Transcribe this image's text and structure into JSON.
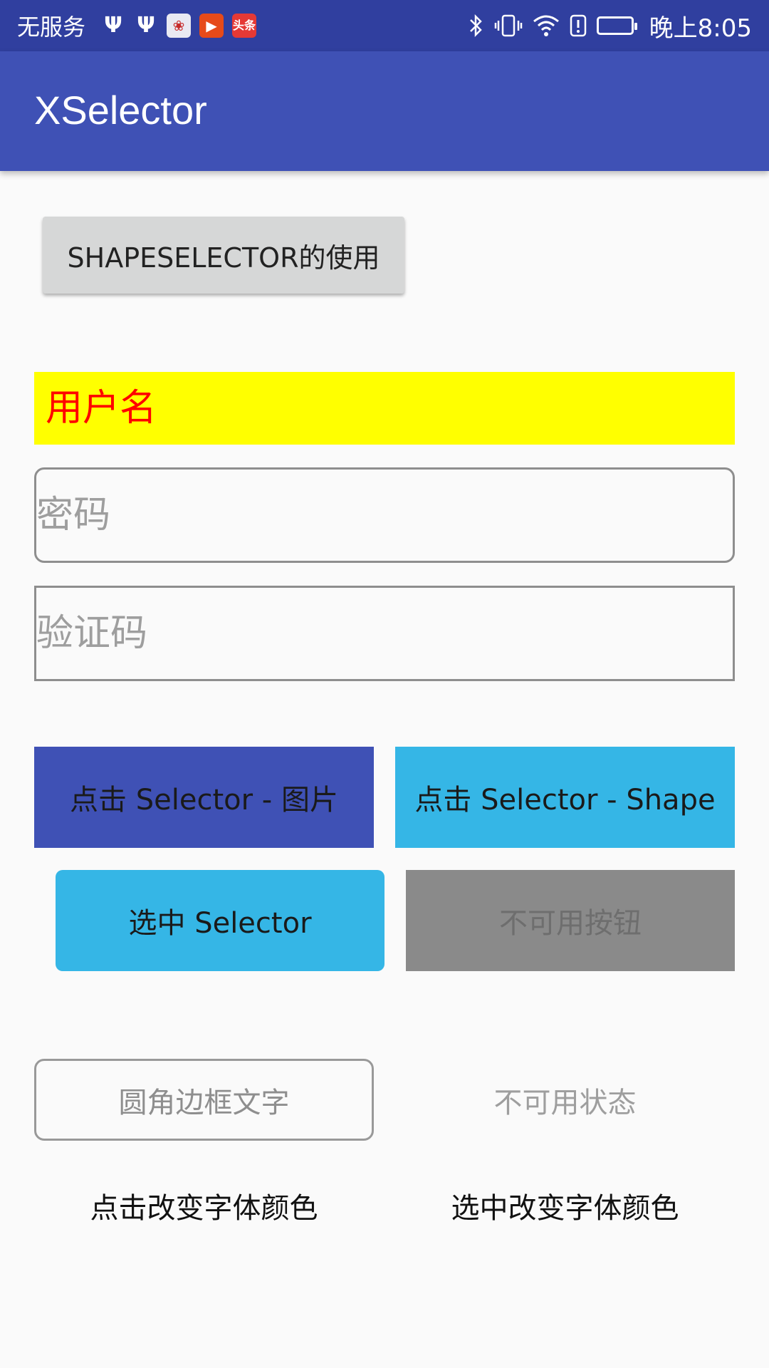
{
  "status_bar": {
    "carrier": "无服务",
    "icons_left": [
      "usb-icon",
      "usb-icon",
      "huawei-app-icon",
      "video-app-icon",
      "news-app-icon"
    ],
    "news_app_label": "头条",
    "icons_right": [
      "bluetooth-icon",
      "vibrate-icon",
      "wifi-icon",
      "alert-icon",
      "battery-icon"
    ],
    "time": "晚上8:05",
    "colors": {
      "background": "#303f9f",
      "battery": "#4caf50"
    }
  },
  "app_bar": {
    "title": "XSelector",
    "color": "#3f51b5"
  },
  "main": {
    "shape_selector_button": "SHAPESELECTOR的使用",
    "username_field": {
      "value": "用户名",
      "background": "#ffff00",
      "text_color": "#ff0000"
    },
    "password_field": {
      "placeholder": "密码"
    },
    "captcha_field": {
      "placeholder": "验证码"
    },
    "click_image_button": "点击 Selector - 图片",
    "click_shape_button": "点击 Selector - Shape",
    "select_button": "选中 Selector",
    "disabled_button": "不可用按钮",
    "rounded_border_text": "圆角边框文字",
    "disabled_state_text": "不可用状态",
    "click_change_font_color": "点击改变字体颜色",
    "select_change_font_color": "选中改变字体颜色",
    "colors": {
      "primary": "#3f51b5",
      "accent": "#35b6e6",
      "disabled": "#8a8a8a"
    }
  }
}
